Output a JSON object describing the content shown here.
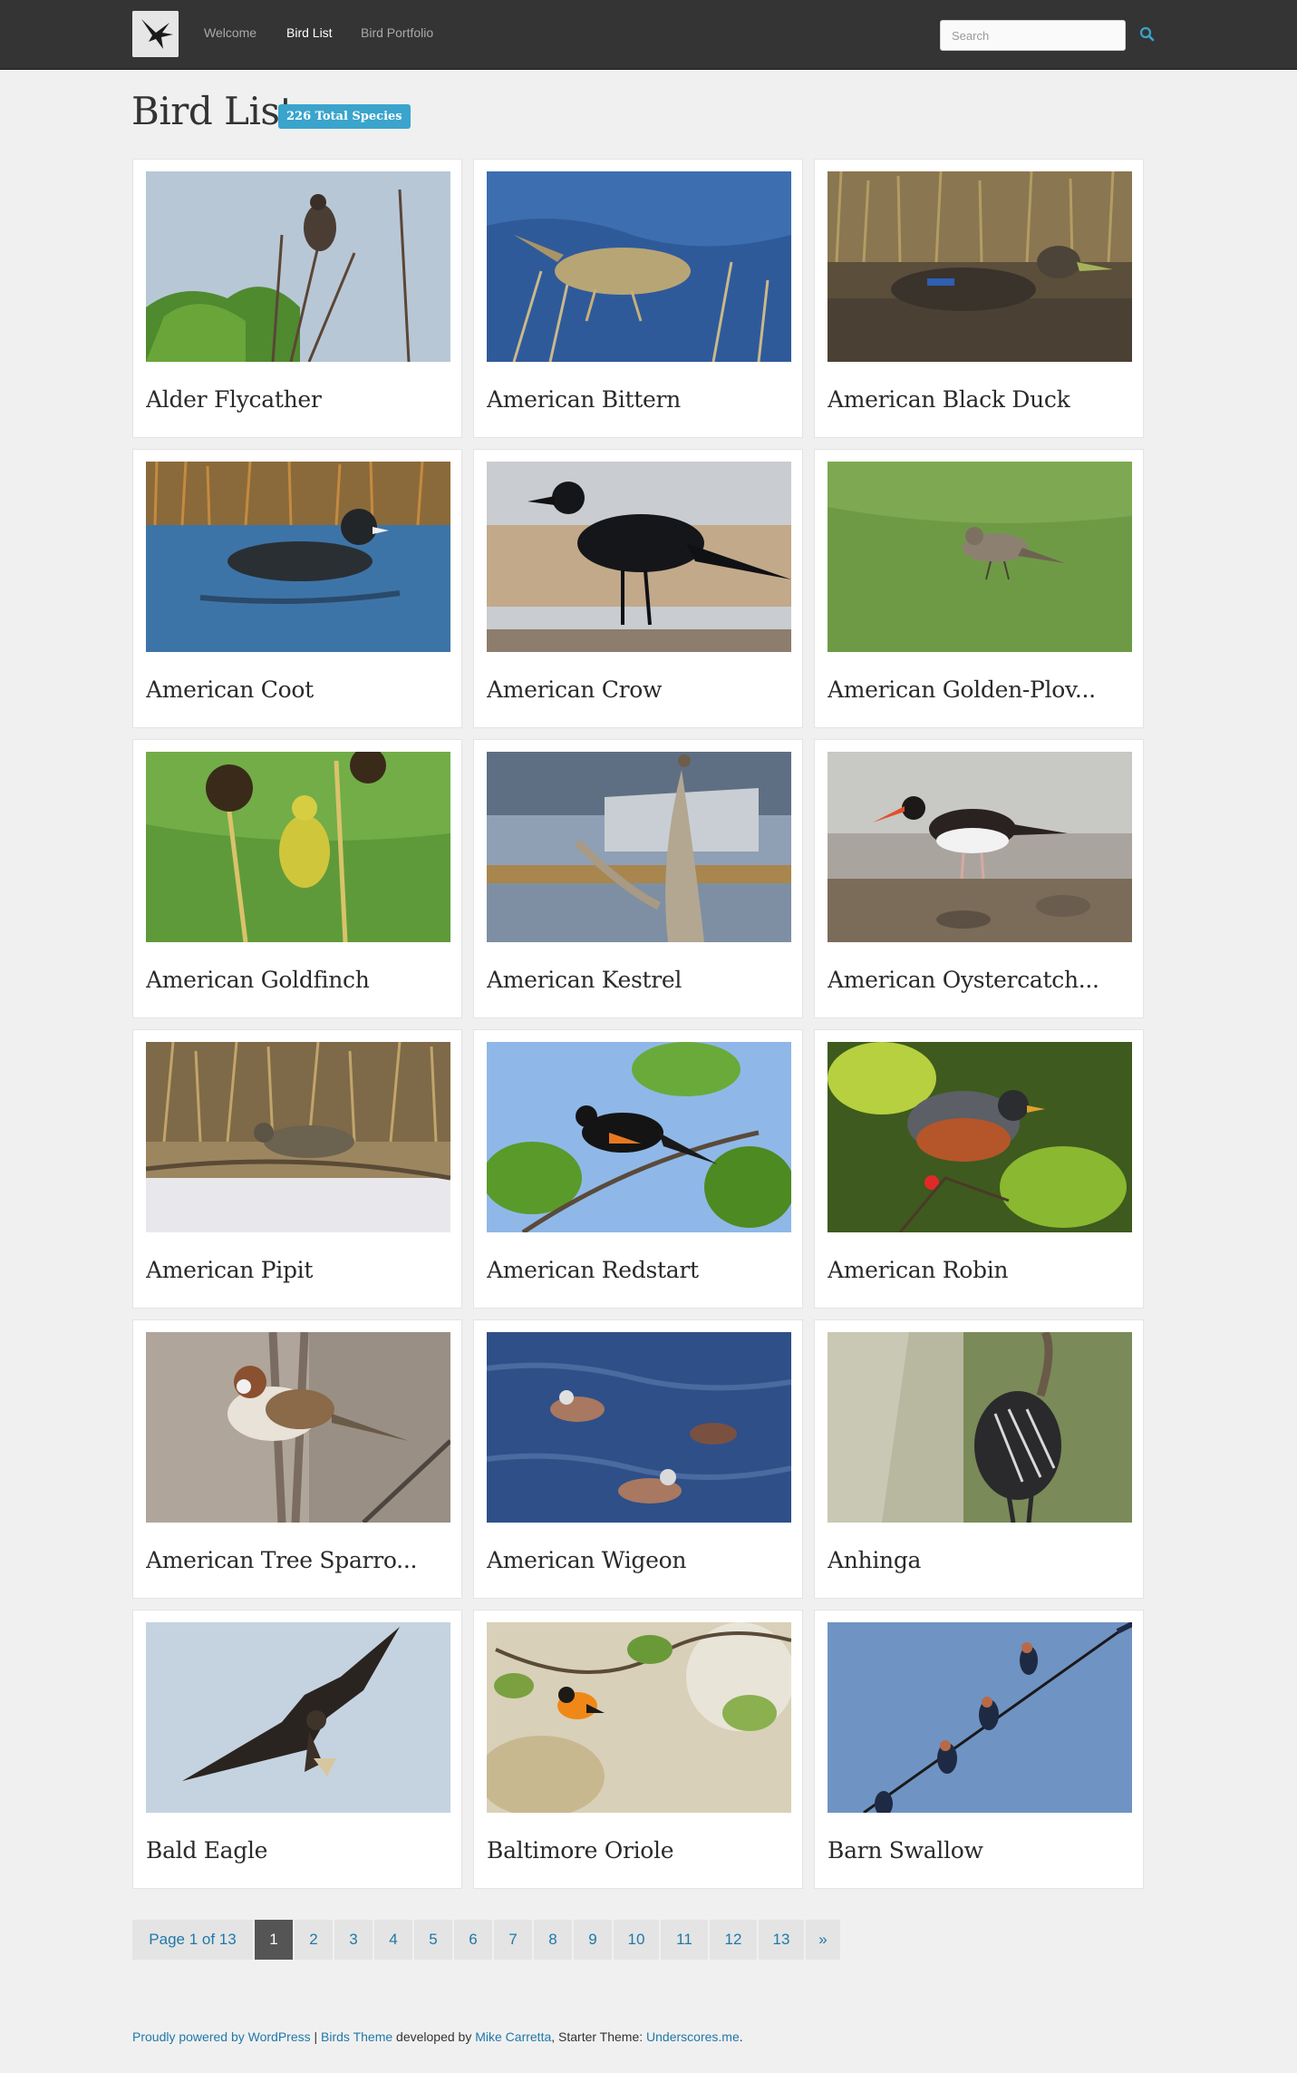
{
  "nav": {
    "links": [
      "Welcome",
      "Bird List",
      "Bird Portfolio"
    ],
    "active": "Bird List",
    "search_placeholder": "Search"
  },
  "page": {
    "title": "Bird List",
    "badge": "226 Total Species"
  },
  "birds": [
    "Alder Flycather",
    "American Bittern",
    "American Black Duck",
    "American Coot",
    "American Crow",
    "American Golden-Plov...",
    "American Goldfinch",
    "American Kestrel",
    "American Oystercatch...",
    "American Pipit",
    "American Redstart",
    "American Robin",
    "American Tree Sparro...",
    "American Wigeon",
    "Anhinga",
    "Bald Eagle",
    "Baltimore Oriole",
    "Barn Swallow"
  ],
  "pagination": {
    "info": "Page 1 of 13",
    "pages": [
      "1",
      "2",
      "3",
      "4",
      "5",
      "6",
      "7",
      "8",
      "9",
      "10",
      "11",
      "12",
      "13"
    ],
    "next": "»",
    "current": "1"
  },
  "footer": {
    "powered": "Proudly powered by WordPress",
    "sep": " | ",
    "theme": "Birds Theme",
    "dev_text": " developed by ",
    "author": "Mike Carretta",
    "starter_text": ", Starter Theme: ",
    "starter": "Underscores.me",
    "end": "."
  },
  "colors": {
    "navbar": "#343434",
    "badge": "#3aa4cc",
    "link": "#1f78a8",
    "page_current": "#555555",
    "background": "#f0f0f0"
  },
  "icons": {
    "logo": "bird-silhouette-logo",
    "search": "search-icon"
  }
}
